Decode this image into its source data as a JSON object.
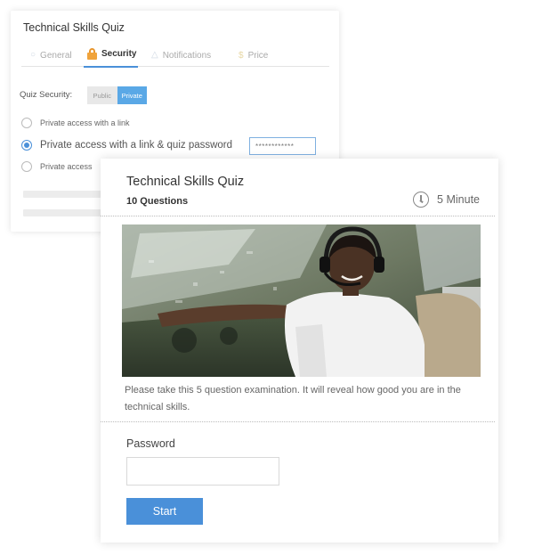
{
  "settings_card": {
    "title": "Technical Skills Quiz",
    "tabs": [
      {
        "label": "General",
        "icon": "circle-icon",
        "active": false
      },
      {
        "label": "Security",
        "icon": "lock-icon",
        "active": true
      },
      {
        "label": "Notifications",
        "icon": "bell-icon",
        "active": false
      },
      {
        "label": "Price",
        "icon": "dollar-icon",
        "active": false
      }
    ],
    "security_label": "Quiz Security:",
    "toggle": {
      "public_label": "Public",
      "private_label": "Private",
      "selected": "Private"
    },
    "options": [
      {
        "label": "Private access with a link",
        "checked": false
      },
      {
        "label": "Private access with a link & quiz password",
        "checked": true
      },
      {
        "label": "Private access",
        "checked": false
      }
    ],
    "password_value": "************"
  },
  "quiz_card": {
    "title": "Technical Skills Quiz",
    "question_count": "10 Questions",
    "duration": "5 Minute",
    "description": "Please take this 5 question examination. It will reveal how good you are in the technical skills.",
    "password_label": "Password",
    "password_value": "",
    "start_label": "Start"
  },
  "colors": {
    "accent": "#4a90d9",
    "toggle_on": "#5aa8e6",
    "lock": "#f0a33b"
  }
}
